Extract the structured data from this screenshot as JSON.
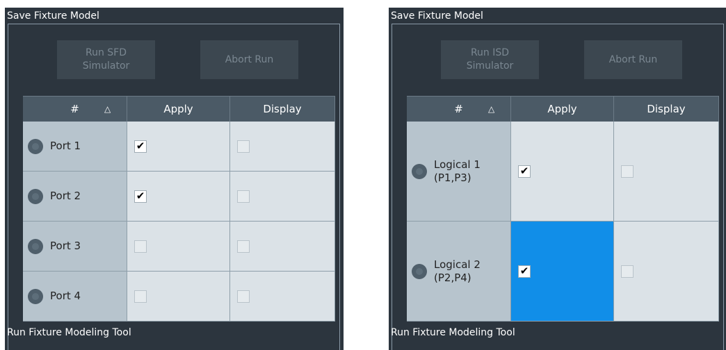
{
  "panels": [
    {
      "title": "Save Fixture Model",
      "run_button": "Run SFD\nSimulator",
      "abort_button": "Abort Run",
      "headers": {
        "name": "#",
        "apply": "Apply",
        "display": "Display"
      },
      "rows": [
        {
          "label": "Port 1",
          "apply": true,
          "display": false,
          "selected": false
        },
        {
          "label": "Port 2",
          "apply": true,
          "display": false,
          "selected": false
        },
        {
          "label": "Port 3",
          "apply": false,
          "display": false,
          "selected": false
        },
        {
          "label": "Port 4",
          "apply": false,
          "display": false,
          "selected": false
        }
      ],
      "footer": "Run Fixture Modeling Tool"
    },
    {
      "title": "Save Fixture Model",
      "run_button": "Run ISD\nSimulator",
      "abort_button": "Abort Run",
      "headers": {
        "name": "#",
        "apply": "Apply",
        "display": "Display"
      },
      "rows": [
        {
          "label": "Logical 1\n(P1,P3)",
          "apply": true,
          "display": false,
          "selected": false
        },
        {
          "label": "Logical 2\n(P2,P4)",
          "apply": true,
          "display": false,
          "selected": true
        }
      ],
      "footer": "Run Fixture Modeling Tool"
    }
  ],
  "icons": {
    "sort": "sort-ascending-icon",
    "port": "port-icon",
    "check": "checkmark-icon"
  },
  "colors": {
    "panel_bg": "#2c353e",
    "header_bg": "#4b5a66",
    "name_cell_bg": "#b7c4cd",
    "cell_bg": "#dbe2e7",
    "selection": "#118ee8"
  }
}
